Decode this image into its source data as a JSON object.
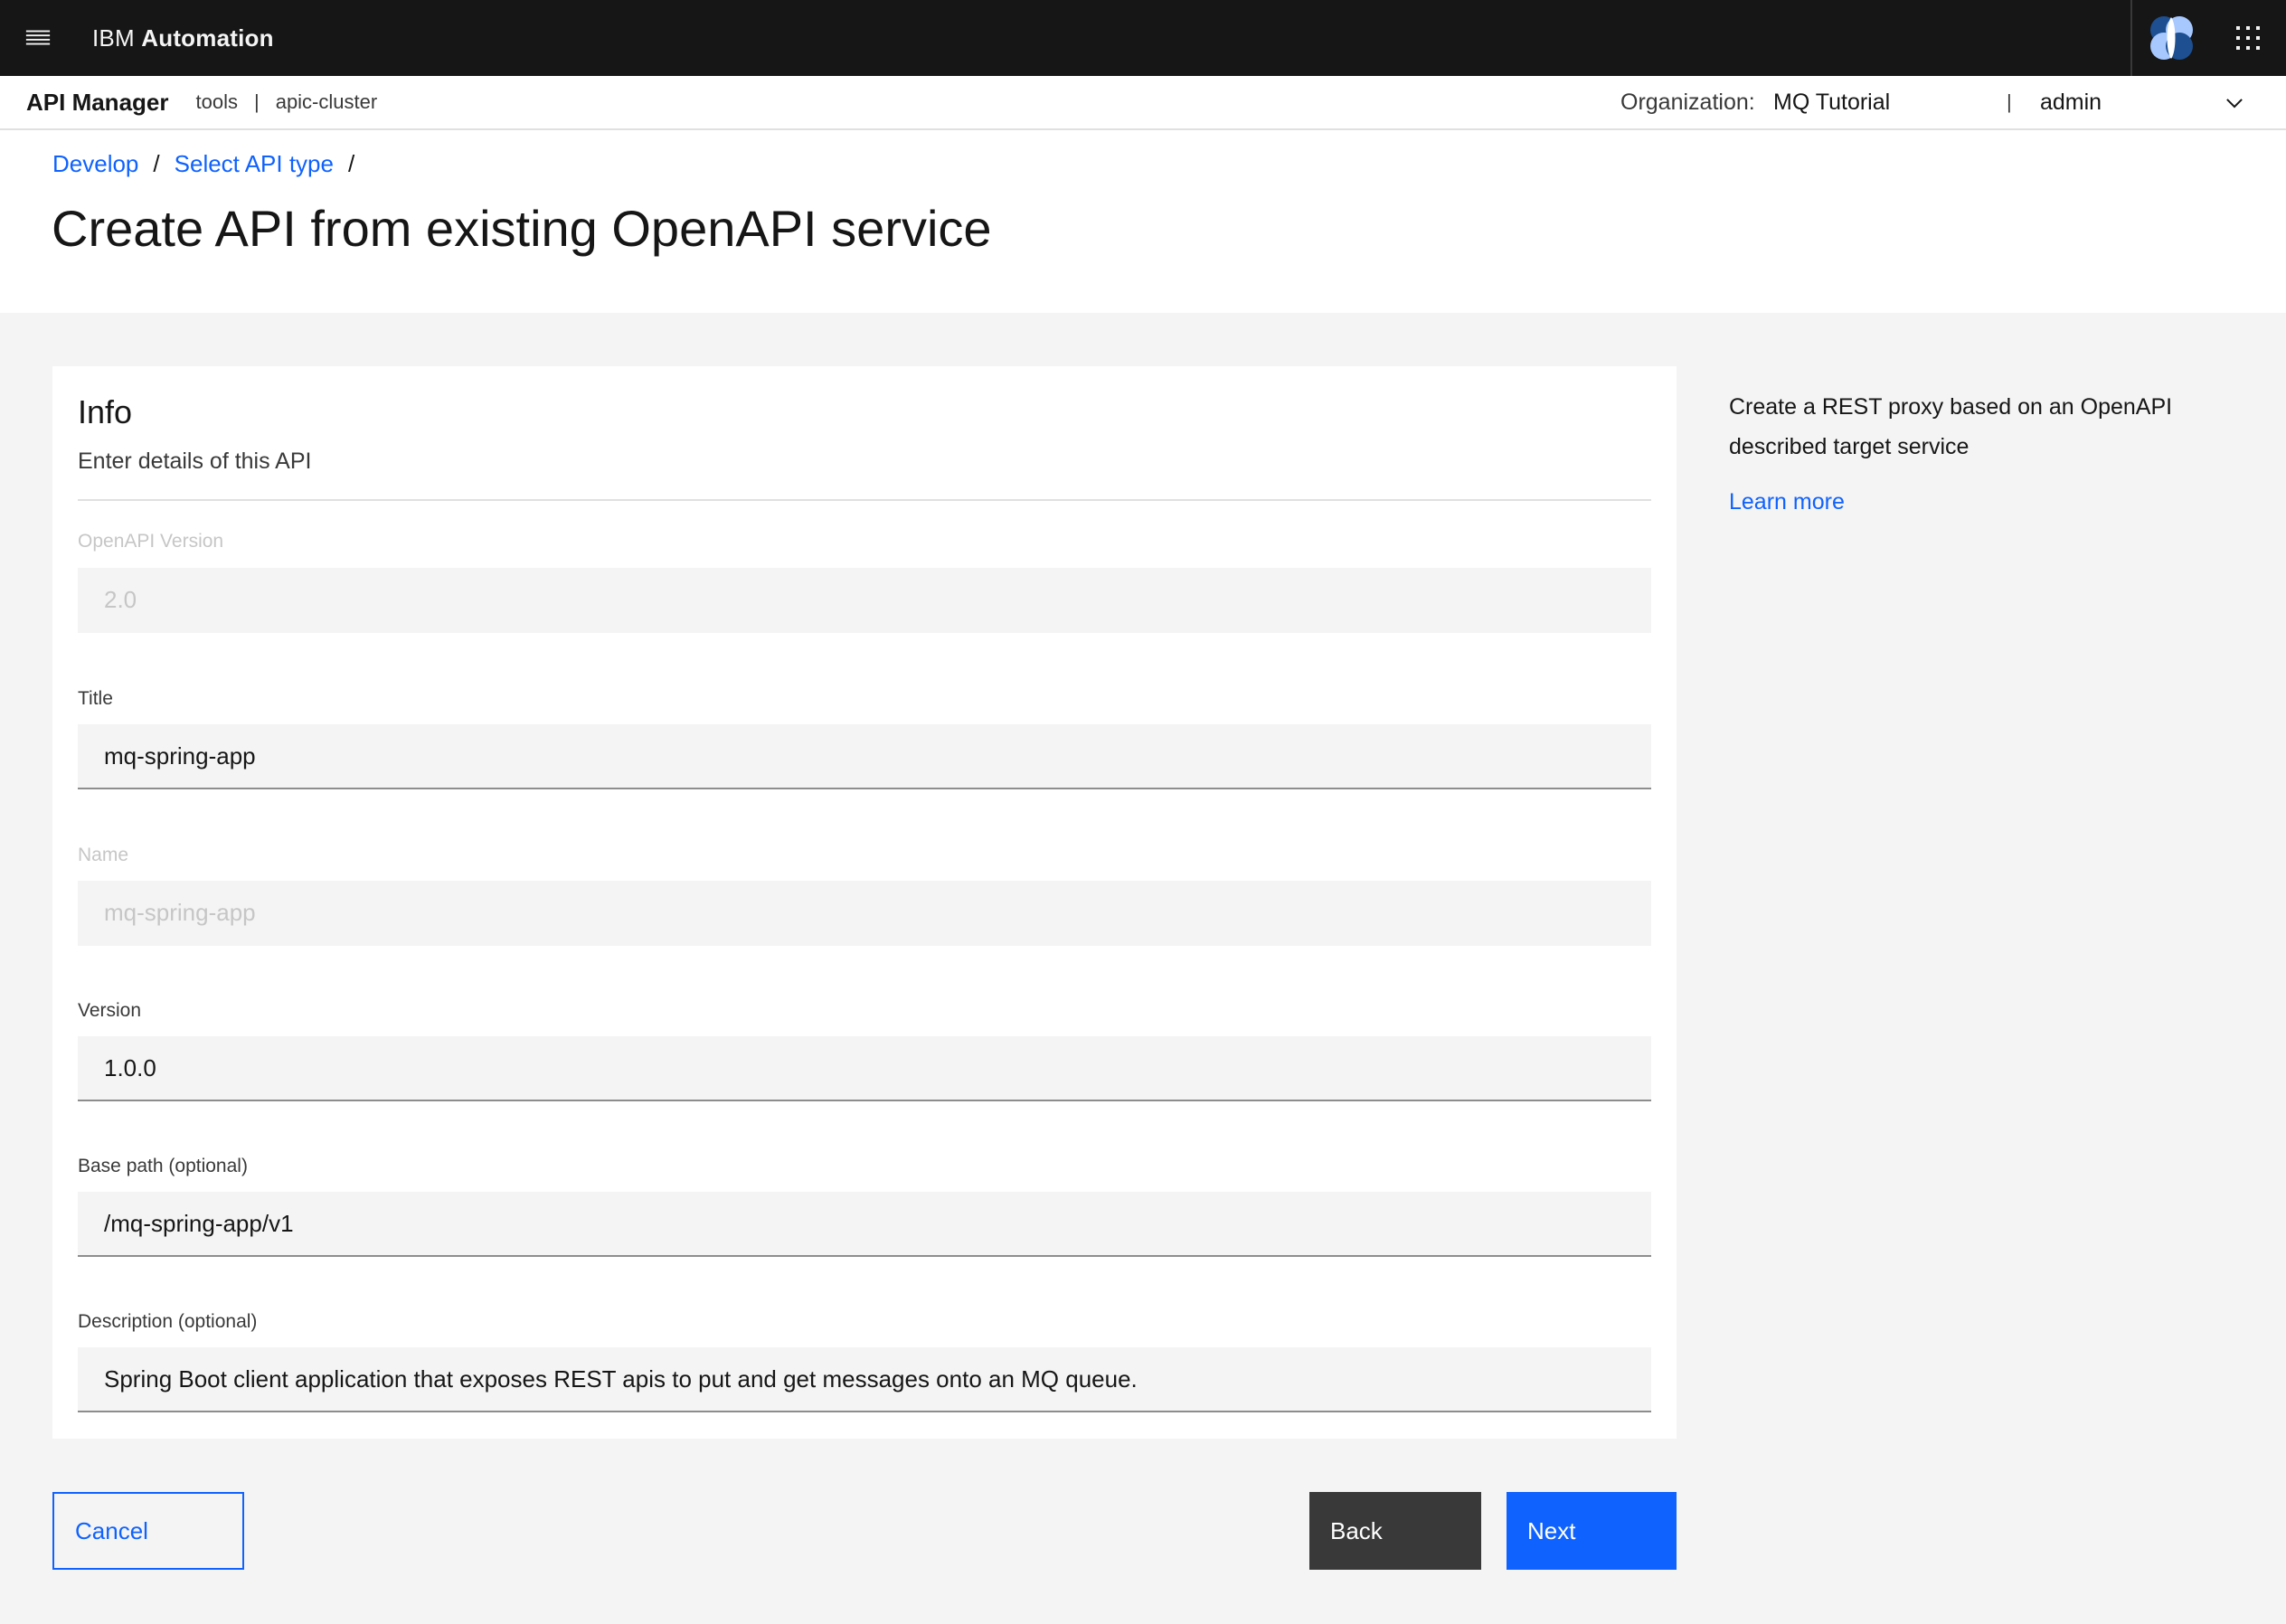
{
  "masthead": {
    "brand_prefix": "IBM",
    "brand_name": "Automation",
    "menu_icon": "menu-icon",
    "avatar_icon": "automation-avatar-icon",
    "switcher_icon": "app-switcher-icon"
  },
  "subbar": {
    "product": "API Manager",
    "context_1": "tools",
    "context_sep": "|",
    "context_2": "apic-cluster",
    "org_label": "Organization:",
    "org_value": "MQ Tutorial",
    "user_sep": "|",
    "user": "admin"
  },
  "breadcrumbs": {
    "item_1": "Develop",
    "item_2": "Select API type",
    "sep": "/"
  },
  "page_title": "Create API from existing OpenAPI service",
  "card": {
    "heading": "Info",
    "subheading": "Enter details of this API",
    "fields": {
      "openapi_version": {
        "label": "OpenAPI Version",
        "value": "2.0"
      },
      "title": {
        "label": "Title",
        "value": "mq-spring-app"
      },
      "name": {
        "label": "Name",
        "value": "mq-spring-app"
      },
      "version": {
        "label": "Version",
        "value": "1.0.0"
      },
      "base_path": {
        "label": "Base path (optional)",
        "value": "/mq-spring-app/v1"
      },
      "description": {
        "label": "Description (optional)",
        "value": "Spring Boot client application that exposes REST apis to put and get messages onto an MQ queue."
      }
    }
  },
  "aside": {
    "text": "Create a REST proxy based on an OpenAPI described target service",
    "link": "Learn more"
  },
  "actions": {
    "cancel": "Cancel",
    "back": "Back",
    "next": "Next"
  },
  "colors": {
    "masthead_bg": "#161616",
    "link": "#0f62fe",
    "primary": "#0f62fe",
    "secondary": "#393939"
  }
}
